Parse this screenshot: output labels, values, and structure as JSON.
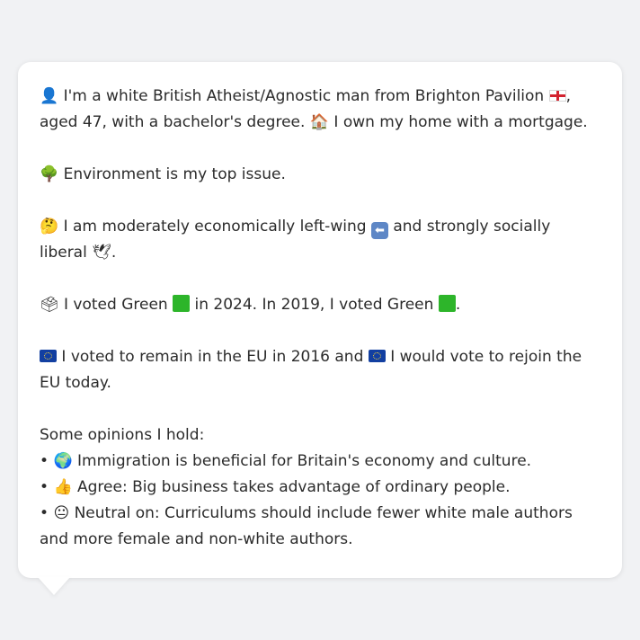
{
  "bubble": {
    "intro": {
      "icon": "person-silhouette-icon",
      "text_before_flag": "I'm a white British Atheist/Agnostic man from Brighton Pavilion",
      "flag": "england-flag-icon",
      "text_after_flag": ", aged 47, with a bachelor's degree.",
      "house_icon": "house-icon",
      "text_home": "I own my home with a mortgage."
    },
    "top_issue": {
      "icon": "tree-icon",
      "text": "Environment is my top issue."
    },
    "ideology": {
      "icon": "thinking-face-icon",
      "text_before": "I am moderately economically left-wing",
      "arrow_icon": "left-arrow-icon",
      "text_middle": "and strongly socially liberal",
      "dove_icon": "dove-icon",
      "text_end": "."
    },
    "votes": {
      "icon": "ballot-box-icon",
      "text_2024": "I voted Green",
      "text_2024_tail": "in 2024. In 2019, I voted Green",
      "end": "."
    },
    "eu": {
      "text_remain": "I voted to remain in the EU in 2016 and",
      "text_rejoin": "I would vote to rejoin the EU today."
    },
    "opinions": {
      "header": "Some opinions I hold:",
      "items": [
        {
          "bullet": "•",
          "icon": "globe-icon",
          "text": "Immigration is beneficial for Britain's economy and culture."
        },
        {
          "bullet": "•",
          "icon": "thumbs-up-icon",
          "text": "Agree: Big business takes advantage of ordinary people."
        },
        {
          "bullet": "•",
          "icon": "neutral-face-icon",
          "text": "Neutral on: Curriculums should include fewer white male authors and more female and non-white authors."
        }
      ]
    }
  },
  "colors": {
    "background": "#f1f2f4",
    "bubble": "#ffffff",
    "text": "#2b2b2b",
    "green_party": "#2db52a",
    "eu_blue": "#123fa1"
  }
}
